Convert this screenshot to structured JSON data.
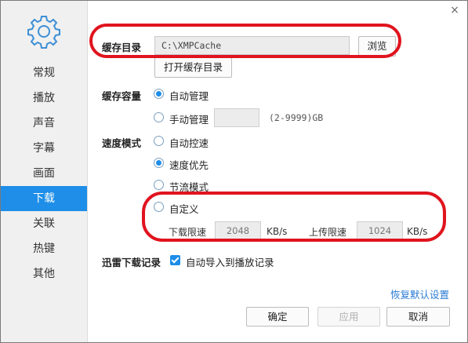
{
  "window": {
    "close_glyph": "×"
  },
  "sidebar": {
    "items": [
      {
        "label": "常规"
      },
      {
        "label": "播放"
      },
      {
        "label": "声音"
      },
      {
        "label": "字幕"
      },
      {
        "label": "画面"
      },
      {
        "label": "下载",
        "active": true
      },
      {
        "label": "关联"
      },
      {
        "label": "热键"
      },
      {
        "label": "其他"
      }
    ]
  },
  "cache_dir": {
    "label": "缓存目录",
    "path": "C:\\XMPCache",
    "browse": "浏览",
    "open": "打开缓存目录"
  },
  "cache_size": {
    "label": "缓存容量",
    "options": [
      {
        "label": "自动管理",
        "selected": true
      },
      {
        "label": "手动管理",
        "selected": false
      }
    ],
    "manual_value": "",
    "range_hint": "(2-9999)GB"
  },
  "speed_mode": {
    "label": "速度模式",
    "options": [
      {
        "label": "自动控速",
        "selected": false
      },
      {
        "label": "速度优先",
        "selected": true
      },
      {
        "label": "节流模式",
        "selected": false
      },
      {
        "label": "自定义",
        "selected": false
      }
    ],
    "download_limit_label": "下载限速",
    "download_limit_value": "2048",
    "download_unit": "KB/s",
    "upload_limit_label": "上传限速",
    "upload_limit_value": "1024",
    "upload_unit": "KB/s"
  },
  "record": {
    "label": "迅雷下载记录",
    "checkbox_label": "自动导入到播放记录",
    "checked": true
  },
  "footer": {
    "restore_defaults": "恢复默认设置",
    "ok": "确定",
    "apply": "应用",
    "cancel": "取消"
  },
  "colors": {
    "accent": "#1e8ee8",
    "annotation": "#e0141e"
  }
}
